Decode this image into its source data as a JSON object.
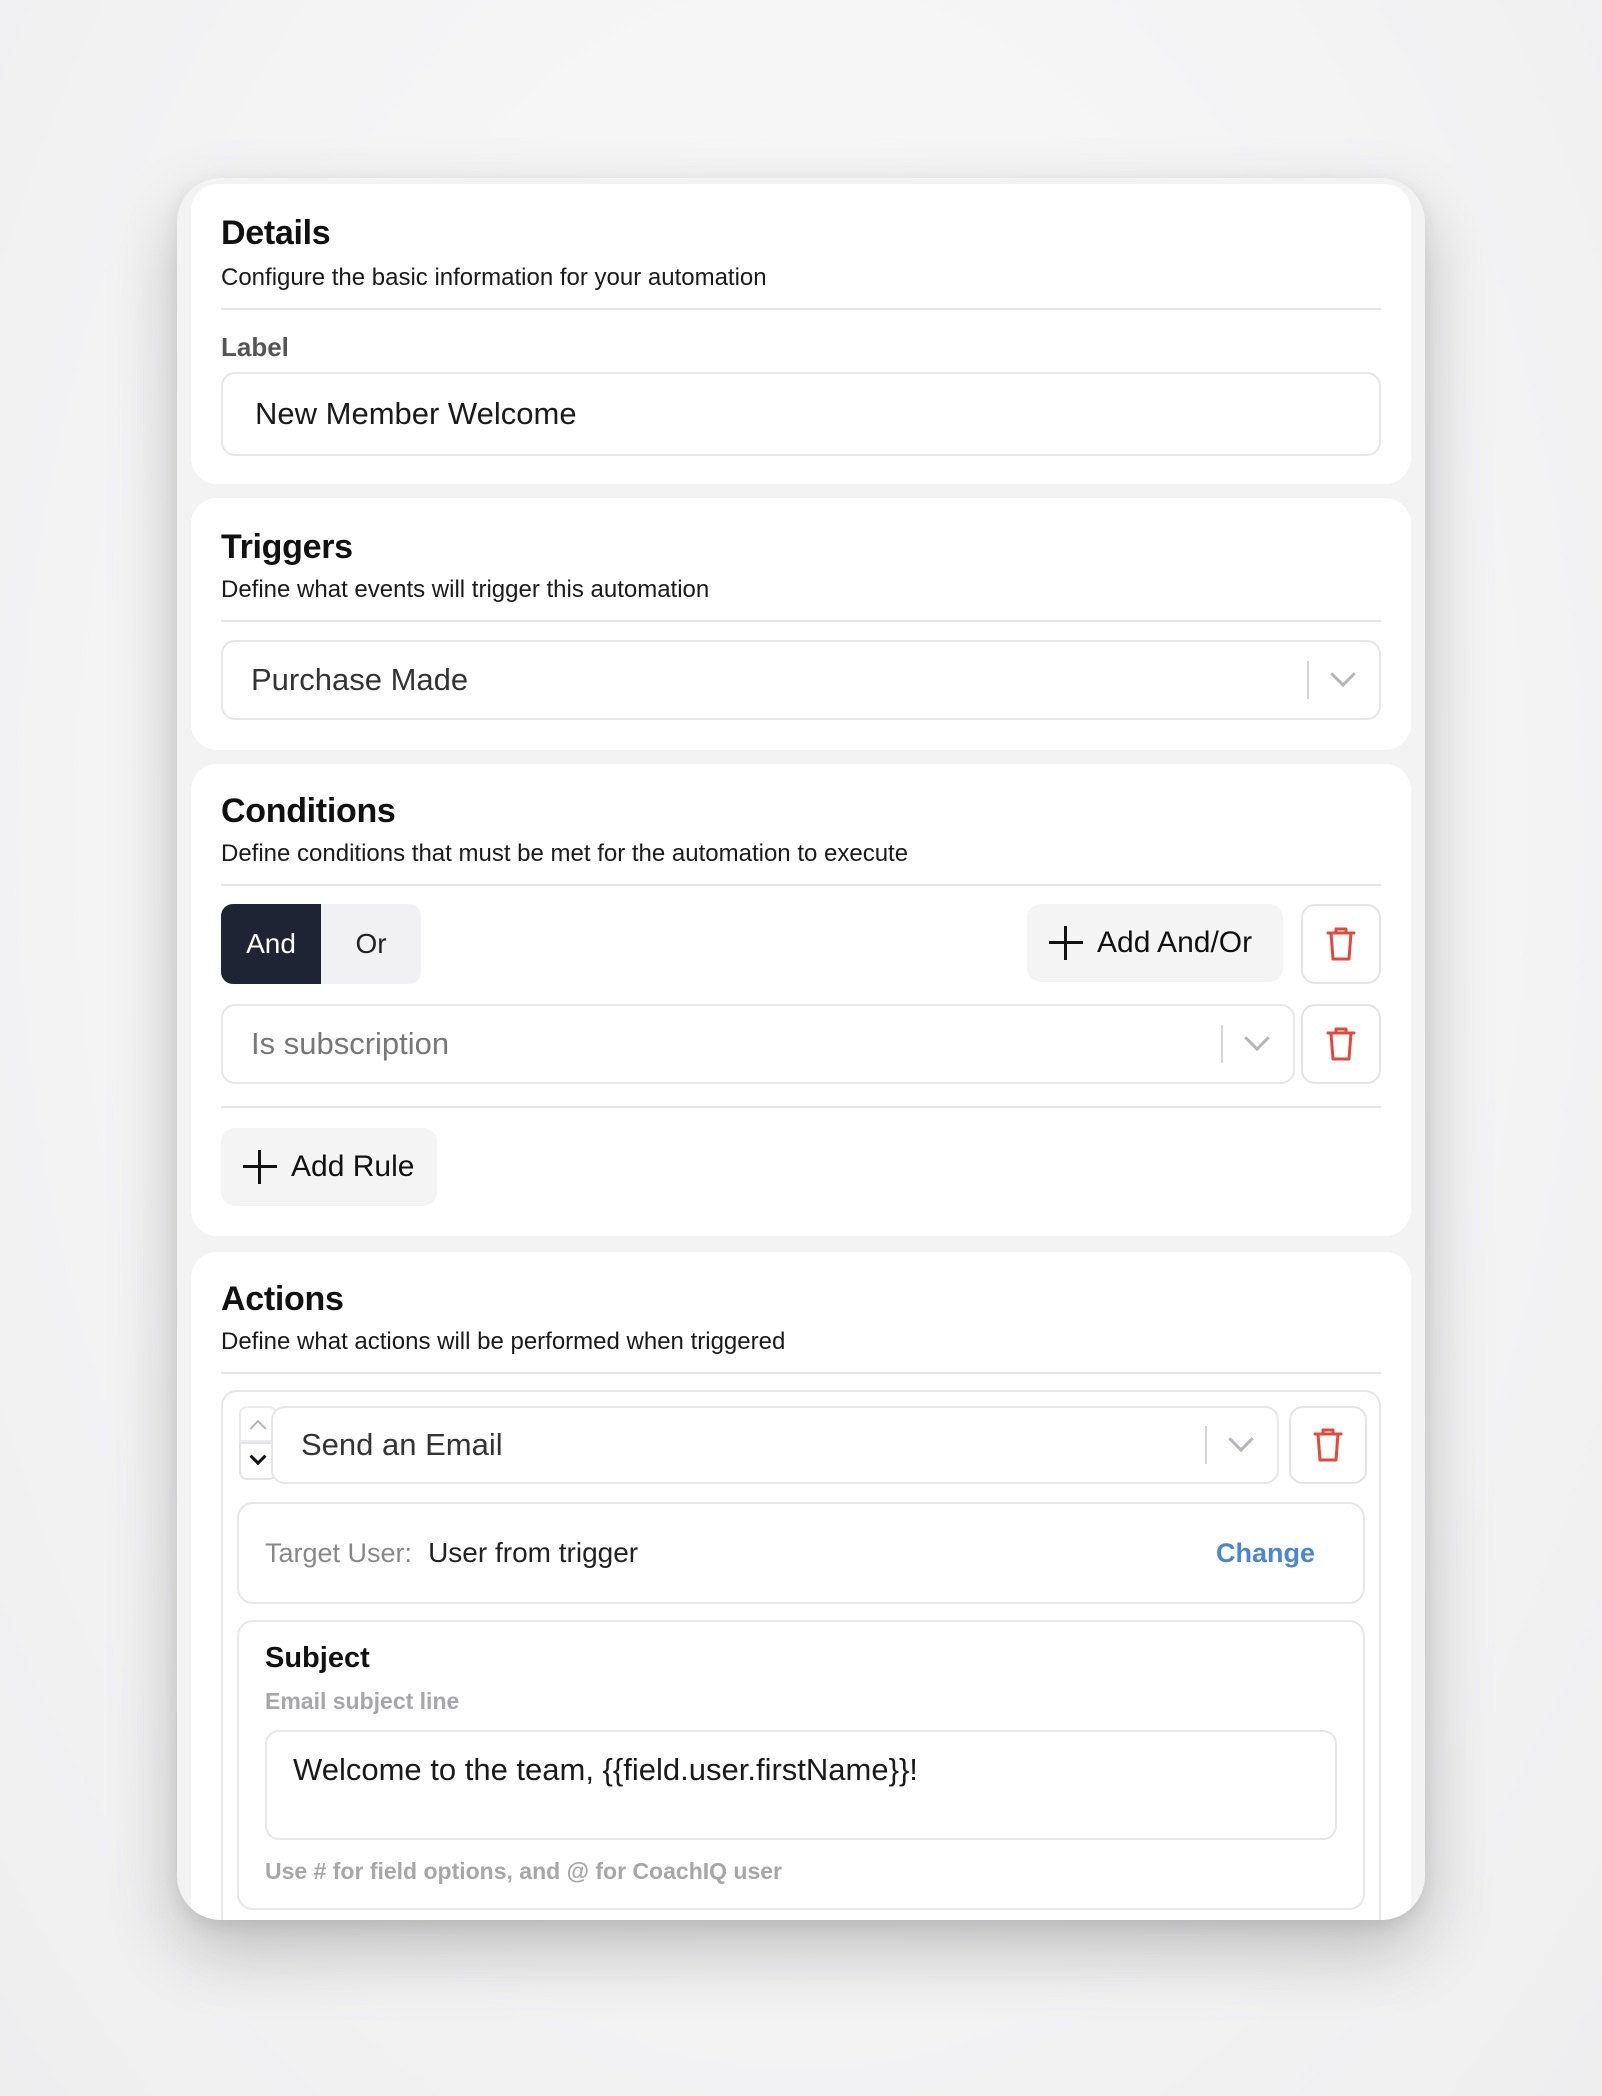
{
  "details": {
    "title": "Details",
    "subtitle": "Configure the basic information for your automation",
    "label_caption": "Label",
    "label_value": "New Member Welcome"
  },
  "triggers": {
    "title": "Triggers",
    "subtitle": "Define what events will trigger this automation",
    "selected": "Purchase Made"
  },
  "conditions": {
    "title": "Conditions",
    "subtitle": "Define conditions that must be met for the automation to execute",
    "logic_options": [
      "And",
      "Or"
    ],
    "active_logic": "And",
    "add_and_or_label": "Add And/Or",
    "rule_placeholder": "Is subscription",
    "add_rule_label": "Add Rule"
  },
  "actions": {
    "title": "Actions",
    "subtitle": "Define what actions will be performed when triggered",
    "action_selected": "Send an Email",
    "target_user_label": "Target User:",
    "target_user_value": "User from trigger",
    "change_label": "Change",
    "subject_title": "Subject",
    "subject_sub": "Email subject line",
    "subject_value": "Welcome to the team, {{field.user.firstName}}!",
    "subject_hint": "Use # for field options, and @ for CoachIQ user"
  },
  "colors": {
    "accent_dark": "#1e2433",
    "link": "#4a86d8",
    "danger": "#e5483b"
  }
}
